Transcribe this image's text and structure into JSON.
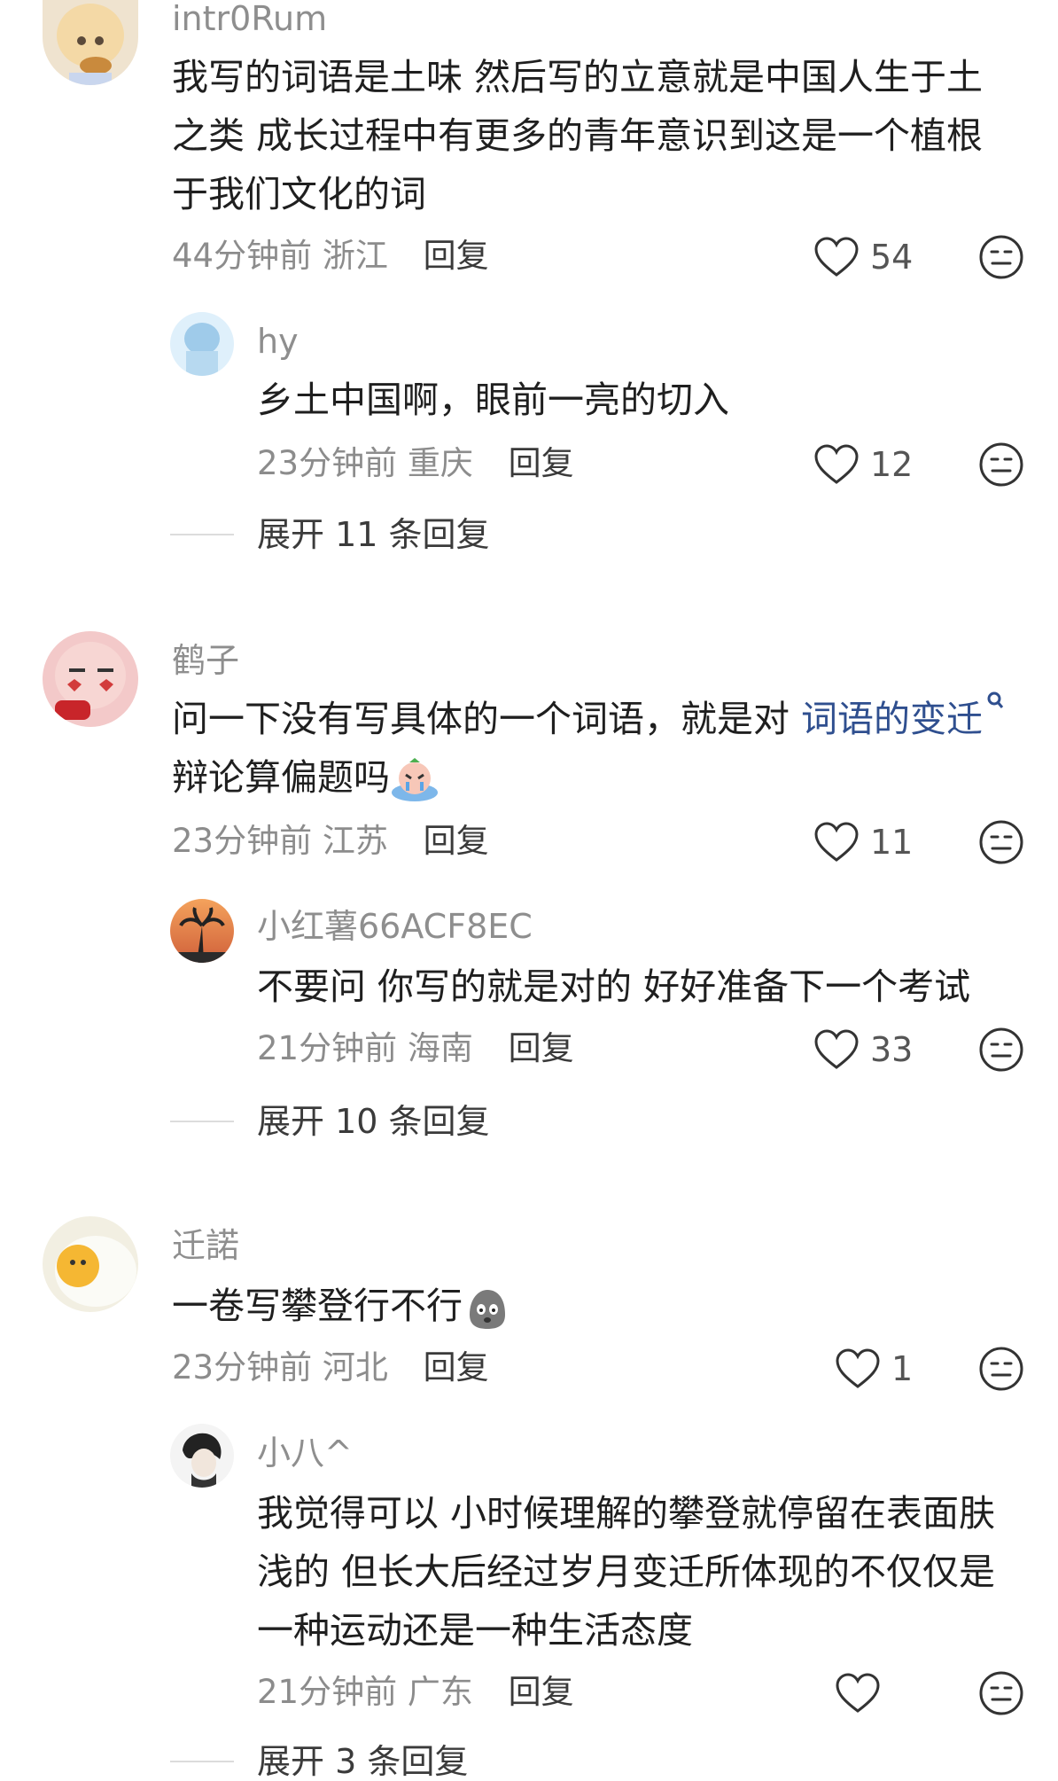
{
  "comments": [
    {
      "user": "intr0Rum",
      "text_lines": [
        "我写的词语是土味 然后写的立意就是中国人生于土",
        "之类 成长过程中有更多的青年意识到这是一个植根",
        "于我们文化的词"
      ],
      "time": "44分钟前",
      "location": "浙江",
      "reply_label": "回复",
      "likes": "54",
      "replies": [
        {
          "user": "hy",
          "text": "乡土中国啊，眼前一亮的切入",
          "time": "23分钟前",
          "location": "重庆",
          "reply_label": "回复",
          "likes": "12"
        }
      ],
      "expand_label": "展开 11 条回复"
    },
    {
      "user": "鹤子",
      "text_line1_before": "问一下没有写具体的一个词语，就是对 ",
      "topic": "词语的变迁",
      "text_line2": "辩论算偏题吗",
      "time": "23分钟前",
      "location": "江苏",
      "reply_label": "回复",
      "likes": "11",
      "replies": [
        {
          "user": "小红薯66ACF8EC",
          "text": "不要问 你写的就是对的 好好准备下一个考试",
          "time": "21分钟前",
          "location": "海南",
          "reply_label": "回复",
          "likes": "33"
        }
      ],
      "expand_label": "展开 10 条回复"
    },
    {
      "user": "迁諾",
      "text": "一卷写攀登行不行",
      "time": "23分钟前",
      "location": "河北",
      "reply_label": "回复",
      "likes": "1",
      "replies": [
        {
          "user": "小八^",
          "text_lines": [
            "我觉得可以 小时候理解的攀登就停留在表面肤",
            "浅的 但长大后经过岁月变迁所体现的不仅仅是",
            "一种运动还是一种生活态度"
          ],
          "time": "21分钟前",
          "location": "广东",
          "reply_label": "回复",
          "likes": ""
        }
      ],
      "expand_label": "展开 3 条回复"
    }
  ],
  "icons": {
    "like": "heart-outline-icon",
    "dislike": "neutral-face-icon",
    "search": "search-magnifier-icon"
  },
  "colors": {
    "topic_link": "#2f4f8f",
    "meta_gray": "#8c8c8c",
    "username_gray": "#8e8e8e"
  }
}
